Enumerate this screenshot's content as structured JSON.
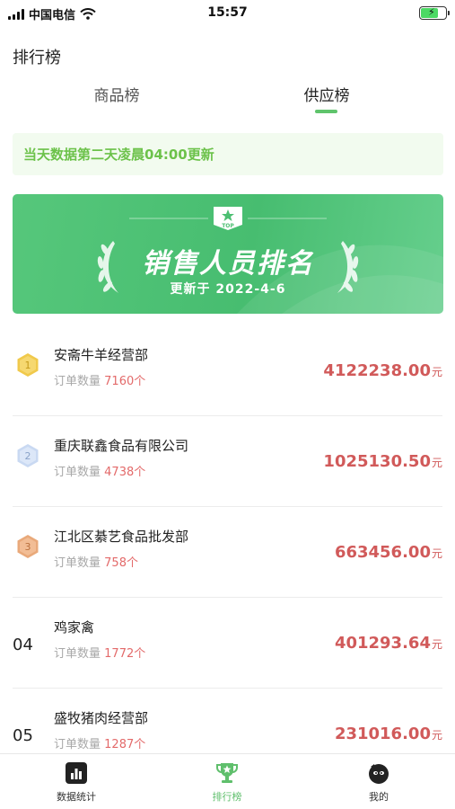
{
  "status_bar": {
    "carrier": "中国电信",
    "time": "15:57"
  },
  "page_title": "排行榜",
  "tabs": [
    {
      "label": "商品榜",
      "active": false
    },
    {
      "label": "供应榜",
      "active": true
    }
  ],
  "notice": "当天数据第二天凌晨04:00更新",
  "banner": {
    "badge": "TOP",
    "title": "销售人员排名",
    "date": "更新于 2022-4-6"
  },
  "order_label": "订单数量",
  "count_unit": "个",
  "currency_unit": "元",
  "rankings": [
    {
      "rank": "1",
      "name": "安斋牛羊经营部",
      "orders": "7160",
      "amount": "4122238.00",
      "medal": "gold"
    },
    {
      "rank": "2",
      "name": "重庆联鑫食品有限公司",
      "orders": "4738",
      "amount": "1025130.50",
      "medal": "silver"
    },
    {
      "rank": "3",
      "name": "江北区綦艺食品批发部",
      "orders": "758",
      "amount": "663456.00",
      "medal": "bronze"
    },
    {
      "rank": "04",
      "name": "鸡家禽",
      "orders": "1772",
      "amount": "401293.64",
      "medal": "none"
    },
    {
      "rank": "05",
      "name": "盛牧猪肉经营部",
      "orders": "1287",
      "amount": "231016.00",
      "medal": "none"
    }
  ],
  "tabbar": [
    {
      "label": "数据统计",
      "icon": "bar-chart-icon",
      "active": false
    },
    {
      "label": "排行榜",
      "icon": "trophy-icon",
      "active": true
    },
    {
      "label": "我的",
      "icon": "profile-icon",
      "active": false
    }
  ],
  "colors": {
    "accent": "#5fc46c",
    "amount": "#d15a5a",
    "banner": "#4fc277"
  }
}
